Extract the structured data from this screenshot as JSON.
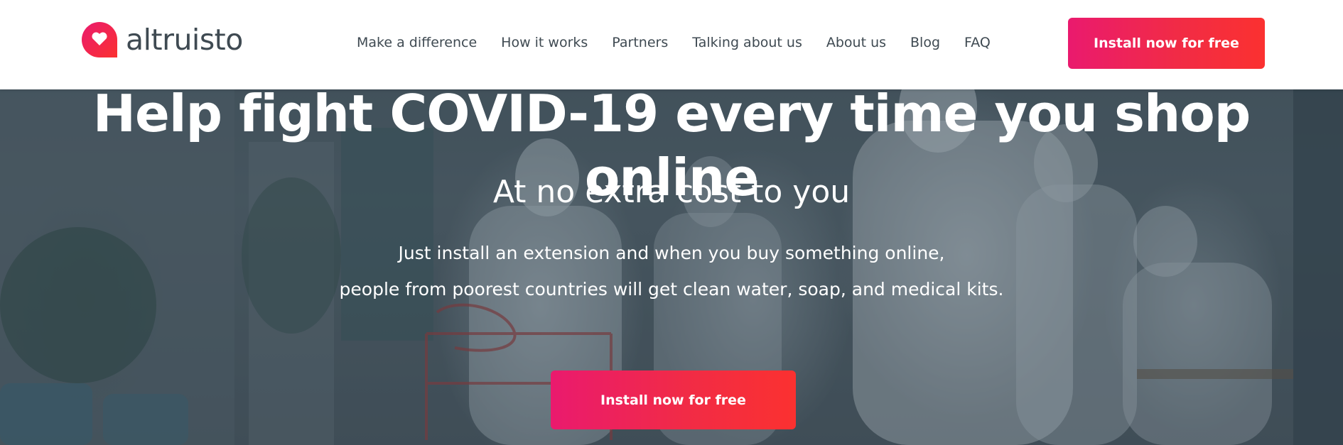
{
  "header": {
    "logo_text": "altruisto",
    "nav": [
      "Make a difference",
      "How it works",
      "Partners",
      "Talking about us",
      "About us",
      "Blog",
      "FAQ"
    ],
    "cta_label": "Install now for free"
  },
  "hero": {
    "title": "Help fight COVID-19 every time you shop online",
    "subtitle": "At no extra cost to you",
    "description_line1": "Just install an extension and when you buy something online,",
    "description_line2": "people from poorest countries will get clean water, soap, and medical kits.",
    "cta_label": "Install now for free"
  },
  "colors": {
    "brand_gradient_start": "#ea1a6e",
    "brand_gradient_end": "#fb3130",
    "text_dark": "#3f4a52",
    "hero_overlay": "#2d3c48"
  },
  "icons": {
    "logo": "heart-speech-bubble-icon"
  }
}
